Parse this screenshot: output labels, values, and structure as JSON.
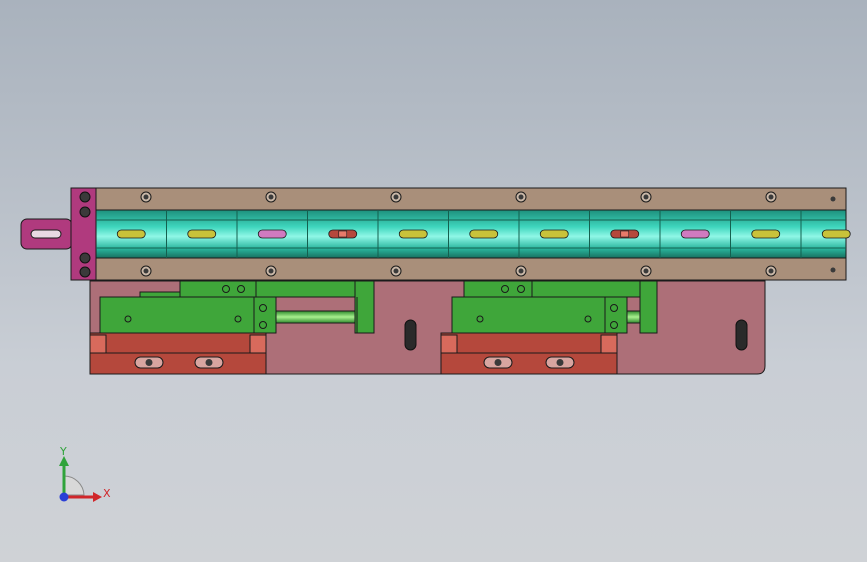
{
  "viewport": {
    "background_top": "#a9b2bd",
    "background_bottom": "#cfd2d6"
  },
  "model": {
    "colors": {
      "rail": "#a98f7a",
      "channel_teal": "#1fb9a0",
      "channel_glow": "#7ff5e2",
      "bracket": "#b03a7e",
      "base_plate": "#ad6f78",
      "block_green": "#3fa63a",
      "block_red": "#b5483c",
      "slot_yellow": "#c9c23a",
      "slot_pink": "#d07ac0",
      "outline": "#1a1a1a"
    },
    "channel_slots": [
      "yellow",
      "yellow",
      "pink",
      "red",
      "yellow",
      "yellow",
      "yellow",
      "red",
      "pink",
      "yellow",
      "yellow"
    ]
  },
  "triad": {
    "y_label": "Y",
    "x_label": "X",
    "y_color": "#2fa33a",
    "x_color": "#d0262a",
    "z_color": "#2a3fd6"
  }
}
